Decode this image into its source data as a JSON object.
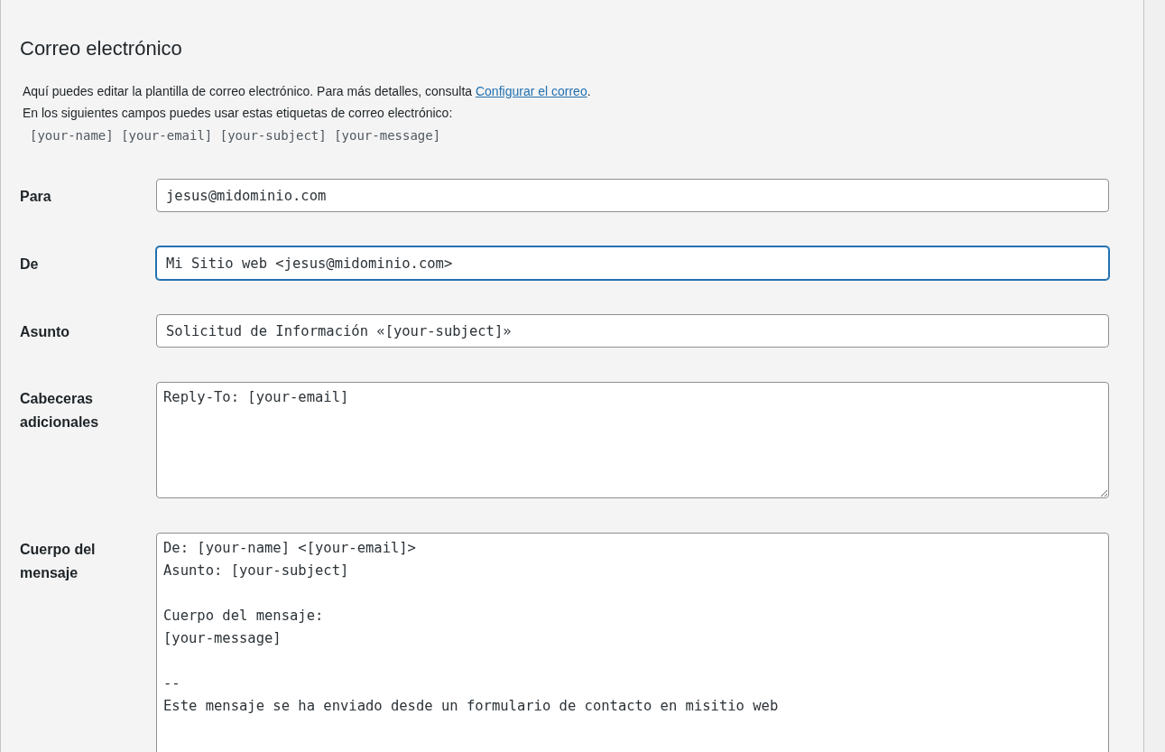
{
  "section": {
    "title": "Correo electrónico",
    "intro": {
      "text_before": "Aquí puedes editar la plantilla de correo electrónico. Para más detalles, consulta ",
      "link": "Configurar el correo",
      "text_after": "."
    },
    "tags_hint": "En los siguientes campos puedes usar estas etiquetas de correo electrónico:",
    "tags": "[your-name] [your-email] [your-subject] [your-message]"
  },
  "fields": [
    {
      "kind": "input",
      "label": "Para",
      "value": "jesus@midominio.com",
      "focused": false
    },
    {
      "kind": "input",
      "label": "De",
      "value": "Mi Sitio web <jesus@midominio.com>",
      "focused": true
    },
    {
      "kind": "input",
      "label": "Asunto",
      "value": "Solicitud de Información «[your-subject]»",
      "focused": false
    },
    {
      "kind": "textarea",
      "label": "Cabeceras adicionales",
      "value": "Reply-To: [your-email]",
      "focused": false
    },
    {
      "kind": "textarea-tall",
      "label": "Cuerpo del mensaje",
      "value": "De: [your-name] <[your-email]>\nAsunto: [your-subject]\n\nCuerpo del mensaje:\n[your-message]\n\n--\nEste mensaje se ha enviado desde un formulario de contacto en misitio web",
      "focused": false
    }
  ]
}
